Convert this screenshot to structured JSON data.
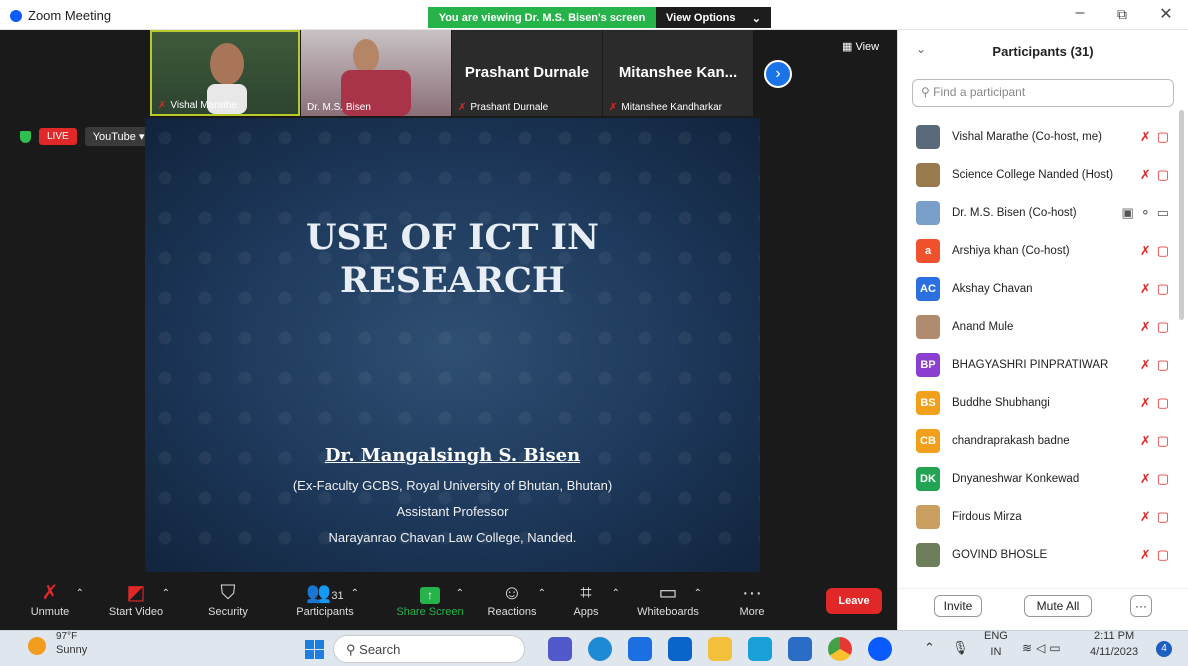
{
  "window": {
    "title": "Zoom Meeting",
    "banner_text": "You are viewing Dr. M.S. Bisen's screen",
    "view_options": "View Options"
  },
  "meeting": {
    "thumbnails": [
      {
        "name": "Vishal Marathe",
        "muted": true,
        "active": true
      },
      {
        "name": "Dr. M.S. Bisen",
        "muted": false,
        "active": false
      },
      {
        "name": "Prashant Durnale",
        "big_name": "Prashant Durnale",
        "muted": true,
        "active": false
      },
      {
        "name": "Mitanshee Kandharkar",
        "big_name": "Mitanshee Kan...",
        "muted": true,
        "active": false
      }
    ],
    "view_label": "View",
    "live_label": "LIVE",
    "youtube_label": "YouTube"
  },
  "slide": {
    "title_line1": "USE OF ICT IN",
    "title_line2": "RESEARCH",
    "author": "Dr. Mangalsingh S. Bisen",
    "line1": "(Ex-Faculty GCBS, Royal University of Bhutan, Bhutan)",
    "line2": "Assistant Professor",
    "line3": "Narayanrao Chavan Law College, Nanded."
  },
  "toolbar": {
    "unmute": "Unmute",
    "start_video": "Start Video",
    "security": "Security",
    "participants": "Participants",
    "participant_count": "31",
    "share_screen": "Share Screen",
    "reactions": "Reactions",
    "apps": "Apps",
    "whiteboards": "Whiteboards",
    "more": "More",
    "leave": "Leave"
  },
  "panel": {
    "title": "Participants (31)",
    "search_placeholder": "Find a participant",
    "participants": [
      {
        "name": "Vishal Marathe (Co-host, me)",
        "initials": "",
        "color": "#5b6a7a",
        "muted": true
      },
      {
        "name": "Science College Nanded (Host)",
        "initials": "",
        "color": "#9a7b4f",
        "muted": true
      },
      {
        "name": "Dr. M.S. Bisen (Co-host)",
        "initials": "",
        "color": "#7aa0c9",
        "muted": false
      },
      {
        "name": "Arshiya khan (Co-host)",
        "initials": "a",
        "color": "#f0512d",
        "muted": true
      },
      {
        "name": "Akshay Chavan",
        "initials": "AC",
        "color": "#2b6fe0",
        "muted": true
      },
      {
        "name": "Anand Mule",
        "initials": "",
        "color": "#b08b6d",
        "muted": true
      },
      {
        "name": "BHAGYASHRI PINPRATIWAR",
        "initials": "BP",
        "color": "#8a3fd1",
        "muted": true
      },
      {
        "name": "Buddhe Shubhangi",
        "initials": "BS",
        "color": "#f2a01b",
        "muted": true
      },
      {
        "name": "chandraprakash badne",
        "initials": "CB",
        "color": "#f2a01b",
        "muted": true
      },
      {
        "name": "Dnyaneshwar Konkewad",
        "initials": "DK",
        "color": "#23a455",
        "muted": true
      },
      {
        "name": "Firdous Mirza",
        "initials": "",
        "color": "#c9a060",
        "muted": true
      },
      {
        "name": "GOVIND BHOSLE",
        "initials": "",
        "color": "#6d7f5a",
        "muted": true
      }
    ],
    "invite": "Invite",
    "mute_all": "Mute All",
    "more": "···"
  },
  "taskbar": {
    "temperature": "97°F",
    "condition": "Sunny",
    "search": "Search",
    "language": "ENG",
    "region": "IN",
    "time": "2:11 PM",
    "date": "4/11/2023",
    "notifications": "4"
  }
}
